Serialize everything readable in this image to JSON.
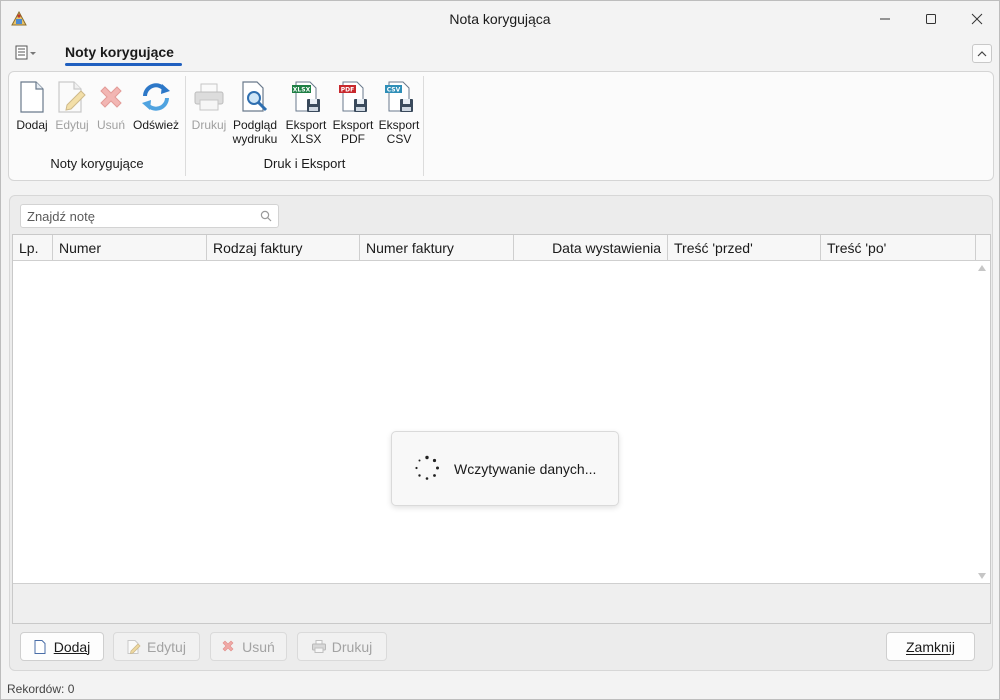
{
  "window": {
    "title": "Nota korygująca",
    "icons": {
      "app": "app-logo-icon",
      "minimize": "minimize-icon",
      "maximize": "maximize-icon",
      "close": "close-icon"
    }
  },
  "ribbon": {
    "tab": "Noty korygujące",
    "groups": [
      {
        "label": "Noty korygujące",
        "buttons": [
          {
            "label": "Dodaj",
            "icon": "new-document-icon",
            "enabled": true
          },
          {
            "label": "Edytuj",
            "icon": "edit-document-icon",
            "enabled": false
          },
          {
            "label": "Usuń",
            "icon": "delete-x-icon",
            "enabled": false
          },
          {
            "label": "Odśwież",
            "icon": "refresh-icon",
            "enabled": true
          }
        ]
      },
      {
        "label": "Druk i Eksport",
        "buttons": [
          {
            "label": "Drukuj",
            "icon": "printer-icon",
            "enabled": false
          },
          {
            "label": "Podgląd wydruku",
            "icon": "print-preview-icon",
            "enabled": true
          },
          {
            "label": "Eksport XLSX",
            "icon": "xlsx-export-icon",
            "badge": "XLSX",
            "enabled": true
          },
          {
            "label": "Eksport PDF",
            "icon": "pdf-export-icon",
            "badge": "PDF",
            "enabled": true
          },
          {
            "label": "Eksport CSV",
            "icon": "csv-export-icon",
            "badge": "CSV",
            "enabled": true
          }
        ]
      }
    ]
  },
  "search": {
    "placeholder": "Znajdź notę",
    "value": ""
  },
  "table": {
    "columns": [
      "Lp.",
      "Numer",
      "Rodzaj faktury",
      "Numer faktury",
      "Data wystawienia",
      "Treść 'przed'",
      "Treść 'po'"
    ],
    "rows": []
  },
  "loading": {
    "text": "Wczytywanie danych..."
  },
  "actions": {
    "add": {
      "label": "Dodaj",
      "enabled": true
    },
    "edit": {
      "label": "Edytuj",
      "enabled": false
    },
    "delete": {
      "label": "Usuń",
      "enabled": false
    },
    "print": {
      "label": "Drukuj",
      "enabled": false
    },
    "close": {
      "label": "Zamknij",
      "enabled": true
    }
  },
  "status": {
    "records": "Rekordów: 0"
  },
  "colors": {
    "accent": "#1f5fbf",
    "disabled_text": "#a0a0a0",
    "xlsx": "#1e7f45",
    "pdf": "#c8282d",
    "csv": "#2f8fb8"
  }
}
